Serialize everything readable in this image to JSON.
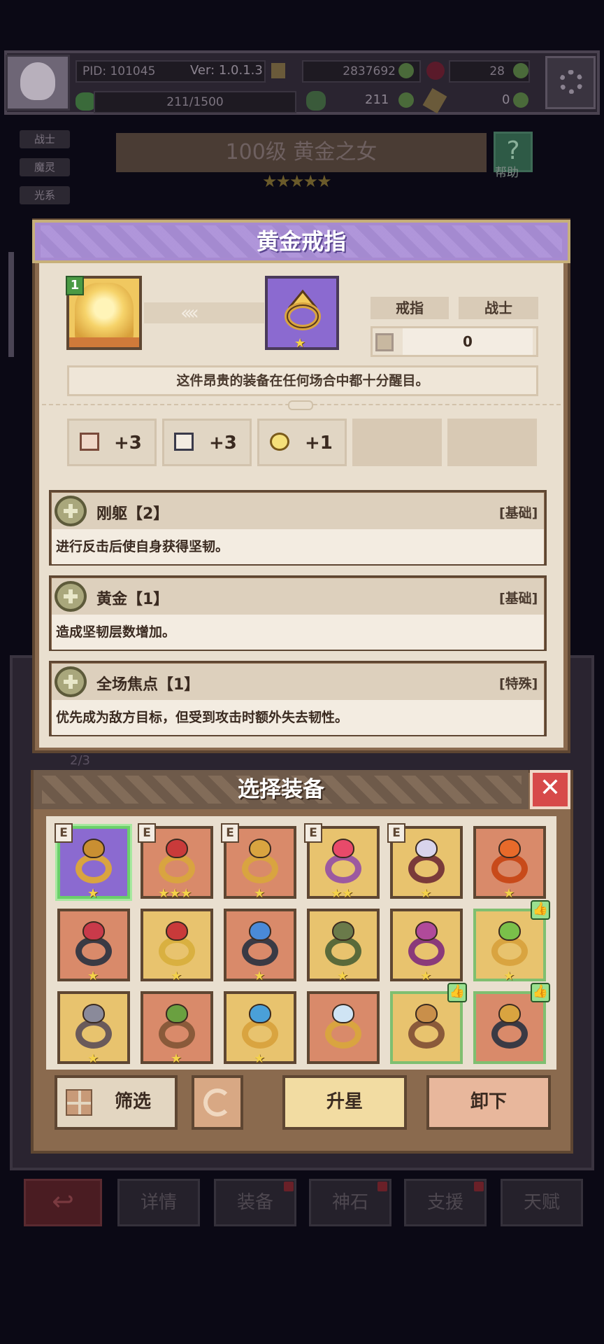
{
  "header": {
    "pid": "PID: 101045",
    "version": "Ver: 1.0.1.3",
    "gold": "2837692",
    "gems": "28",
    "exp": "211/1500",
    "clover": "211",
    "keys": "0"
  },
  "side_tags": [
    "战士",
    "魔灵",
    "光系"
  ],
  "banner": {
    "title": "100级  黄金之女",
    "stars": "★★★★★",
    "help": "帮助"
  },
  "ring": {
    "title": "黄金戒指",
    "hero_level": "1",
    "arrows": "‹‹‹‹",
    "star": "★",
    "type_label": "戒指",
    "class_label": "战士",
    "slot_value": "0",
    "description": "这件昂贵的装备在任何场合中都十分醒目。",
    "stats": [
      {
        "icon": "fist-icon",
        "value": "+3"
      },
      {
        "icon": "book-icon",
        "value": "+3"
      },
      {
        "icon": "clock-icon",
        "value": "+1"
      }
    ],
    "skills": [
      {
        "name": "刚躯【2】",
        "tag": "[基础]",
        "desc": "进行反击后使自身获得坚韧。"
      },
      {
        "name": "黄金【1】",
        "tag": "[基础]",
        "desc": "造成坚韧层数增加。"
      },
      {
        "name": "全场焦点【1】",
        "tag": "[特殊]",
        "desc": "优先成为敌方目标，但受到攻击时额外失去韧性。"
      }
    ]
  },
  "equip": {
    "title": "选择装备",
    "close": "✕",
    "e_badge": "E",
    "thumb": "👍",
    "items": [
      {
        "bg": "purple",
        "stars": "★",
        "equipped": true,
        "selected": true,
        "ring": "#d9a440",
        "gem": "#c98f32"
      },
      {
        "bg": "red",
        "stars": "★★★",
        "equipped": true,
        "ring": "#d9a440",
        "gem": "#c93a3a"
      },
      {
        "bg": "red",
        "stars": "★",
        "equipped": true,
        "ring": "#d9a440",
        "gem": "#d9a440"
      },
      {
        "bg": "gold",
        "stars": "★★",
        "equipped": true,
        "ring": "#9c5aa0",
        "gem": "#e84a6a"
      },
      {
        "bg": "gold",
        "stars": "★",
        "equipped": true,
        "ring": "#7a3a3a",
        "gem": "#d8d4ec"
      },
      {
        "bg": "red",
        "stars": "★",
        "ring": "#c84a1a",
        "gem": "#e86a2a"
      },
      {
        "bg": "red",
        "stars": "★",
        "ring": "#3a3a44",
        "gem": "#c93a4a"
      },
      {
        "bg": "gold",
        "stars": "★",
        "ring": "#d9b040",
        "gem": "#c93a3a"
      },
      {
        "bg": "red",
        "stars": "★",
        "ring": "#3a3a44",
        "gem": "#4a8ad8"
      },
      {
        "bg": "gold",
        "stars": "★",
        "ring": "#5a6a3a",
        "gem": "#6a7a4a"
      },
      {
        "bg": "gold",
        "stars": "★",
        "ring": "#8a3a7a",
        "gem": "#b04a9a"
      },
      {
        "bg": "gold",
        "stars": "★",
        "thumb": true,
        "ring": "#d9a440",
        "gem": "#7ac04a"
      },
      {
        "bg": "gold",
        "stars": "★",
        "ring": "#6a5a5a",
        "gem": "#8a8a9a"
      },
      {
        "bg": "red",
        "stars": "★",
        "ring": "#8a5a3a",
        "gem": "#6aa040"
      },
      {
        "bg": "gold",
        "stars": "★",
        "ring": "#d9a440",
        "gem": "#4aa0d8"
      },
      {
        "bg": "red",
        "stars": "",
        "ring": "#d9a440",
        "gem": "#cfe4f4"
      },
      {
        "bg": "gold",
        "stars": "",
        "thumb": true,
        "ring": "#8a5a3a",
        "gem": "#c98f4a"
      },
      {
        "bg": "red",
        "stars": "",
        "thumb": true,
        "ring": "#3a3a44",
        "gem": "#d9a440"
      }
    ],
    "buttons": {
      "filter": "筛选",
      "upgrade": "升星",
      "unequip": "卸下"
    }
  },
  "bottom_tabs": [
    "详情",
    "装备",
    "神石",
    "支援",
    "天赋"
  ],
  "bg_count": "2/3",
  "colors": {
    "accent_purple": "#a78ad0",
    "panel_brown": "#8a6a4e",
    "parchment": "#e9dfcf",
    "close_red": "#d74a4a"
  }
}
